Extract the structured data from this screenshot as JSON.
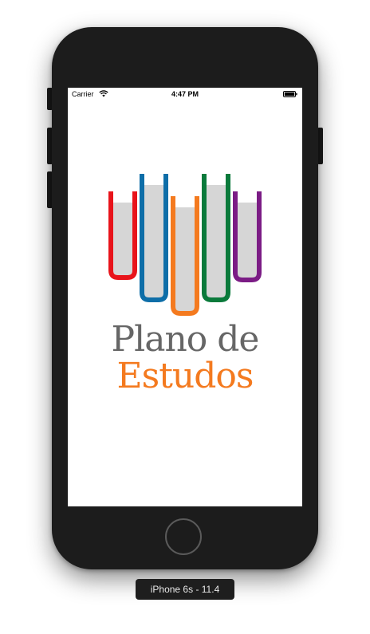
{
  "status_bar": {
    "carrier": "Carrier",
    "time": "4:47 PM",
    "wifi_icon": "wifi-icon",
    "battery_icon": "battery-full-icon"
  },
  "logo": {
    "line1": "Plano de",
    "line2": "Estudos",
    "line1_color": "#666666",
    "line2_color": "#F47A1F",
    "book_colors": [
      "#E8141B",
      "#0E6EA8",
      "#F47A1F",
      "#0A7A3B",
      "#7B1C85"
    ],
    "page_color": "#D6D6D6"
  },
  "simulator": {
    "device_label": "iPhone 6s - 11.4"
  }
}
